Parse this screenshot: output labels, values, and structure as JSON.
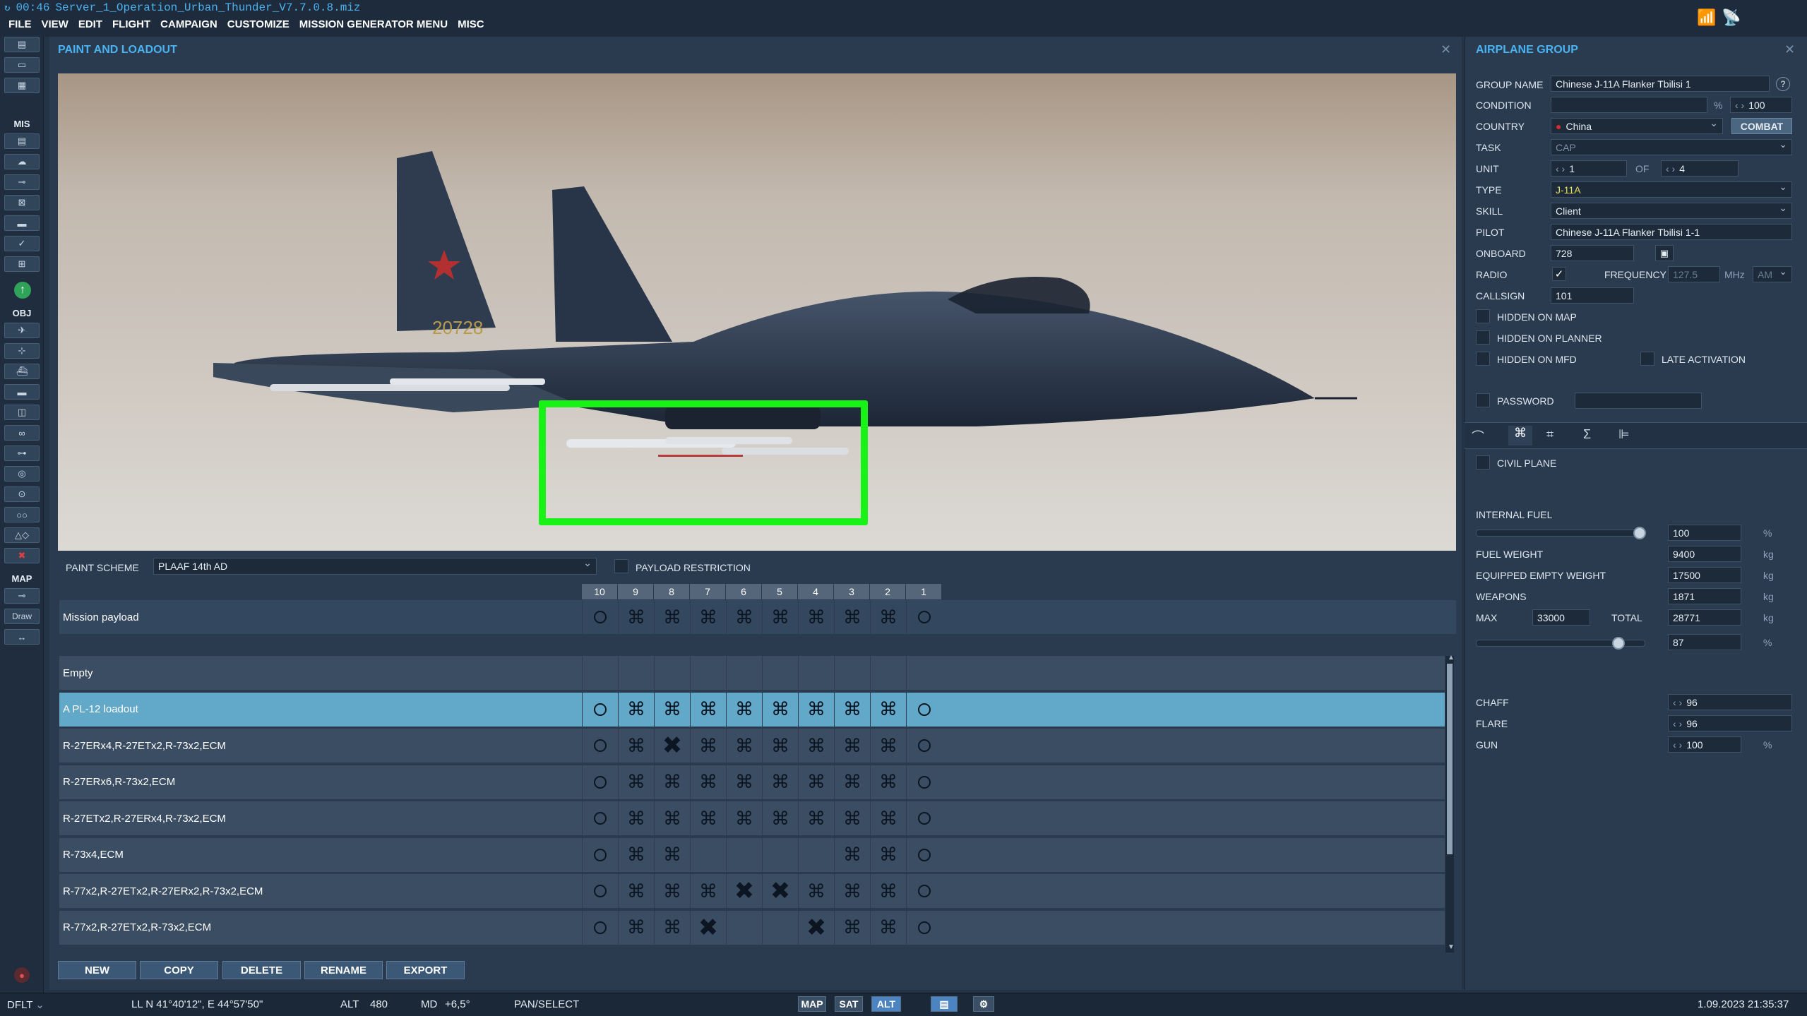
{
  "app": {
    "time": "00:46",
    "file": "Server_1_Operation_Urban_Thunder_V7.7.0.8.miz"
  },
  "menu": [
    "FILE",
    "VIEW",
    "EDIT",
    "FLIGHT",
    "CAMPAIGN",
    "CUSTOMIZE",
    "MISSION GENERATOR MENU",
    "MISC"
  ],
  "lefttb": {
    "mis": "MIS",
    "obj": "OBJ",
    "map": "MAP",
    "draw": "Draw"
  },
  "paint": {
    "title": "PAINT AND LOADOUT",
    "scheme_label": "PAINT SCHEME",
    "scheme_value": "PLAAF 14th AD",
    "payload_restriction": "PAYLOAD RESTRICTION",
    "tail_number": "20728",
    "stations": [
      "10",
      "9",
      "8",
      "7",
      "6",
      "5",
      "4",
      "3",
      "2",
      "1"
    ],
    "mission_row": {
      "name": "Mission payload",
      "cells": [
        "o",
        "x",
        "x",
        "x",
        "x",
        "x",
        "x",
        "x",
        "x",
        "o"
      ]
    },
    "loadouts": [
      {
        "name": "Empty",
        "cells": [
          "",
          "",
          "",
          "",
          "",
          "",
          "",
          "",
          "",
          ""
        ]
      },
      {
        "name": "A PL-12 loadout",
        "cells": [
          "o",
          "x",
          "x",
          "x",
          "x",
          "x",
          "x",
          "x",
          "x",
          "o"
        ]
      },
      {
        "name": "R-27ERx4,R-27ETx2,R-73x2,ECM",
        "cells": [
          "o",
          "x",
          "X",
          "x",
          "x",
          "x",
          "x",
          "x",
          "x",
          "o"
        ]
      },
      {
        "name": "R-27ERx6,R-73x2,ECM",
        "cells": [
          "o",
          "x",
          "x",
          "x",
          "x",
          "x",
          "x",
          "x",
          "x",
          "o"
        ]
      },
      {
        "name": "R-27ETx2,R-27ERx4,R-73x2,ECM",
        "cells": [
          "o",
          "x",
          "x",
          "x",
          "x",
          "x",
          "x",
          "x",
          "x",
          "o"
        ]
      },
      {
        "name": "R-73x4,ECM",
        "cells": [
          "o",
          "x",
          "x",
          "",
          "",
          "",
          "",
          "x",
          "x",
          "o"
        ]
      },
      {
        "name": "R-77x2,R-27ETx2,R-27ERx2,R-73x2,ECM",
        "cells": [
          "o",
          "x",
          "x",
          "x",
          "X",
          "X",
          "x",
          "x",
          "x",
          "o"
        ]
      },
      {
        "name": "R-77x2,R-27ETx2,R-73x2,ECM",
        "cells": [
          "o",
          "x",
          "x",
          "X",
          "",
          "",
          "X",
          "x",
          "x",
          "o"
        ]
      }
    ],
    "buttons": [
      "NEW",
      "COPY",
      "DELETE",
      "RENAME",
      "EXPORT"
    ]
  },
  "group": {
    "title": "AIRPLANE GROUP",
    "labels": {
      "group_name": "GROUP NAME",
      "condition": "CONDITION",
      "country": "COUNTRY",
      "task": "TASK",
      "unit": "UNIT",
      "type": "TYPE",
      "skill": "SKILL",
      "pilot": "PILOT",
      "onboard": "ONBOARD",
      "radio": "RADIO",
      "frequency": "FREQUENCY",
      "callsign": "CALLSIGN",
      "hidden_map": "HIDDEN ON MAP",
      "hidden_planner": "HIDDEN ON PLANNER",
      "hidden_mfd": "HIDDEN ON MFD",
      "late_activation": "LATE ACTIVATION",
      "password": "PASSWORD",
      "civil": "CIVIL PLANE",
      "internal_fuel": "INTERNAL FUEL",
      "fuel_weight": "FUEL WEIGHT",
      "empty_weight": "EQUIPPED EMPTY WEIGHT",
      "weapons": "WEAPONS",
      "max": "MAX",
      "total": "TOTAL",
      "chaff": "CHAFF",
      "flare": "FLARE",
      "gun": "GUN",
      "of": "OF",
      "combat": "COMBAT",
      "help": "?"
    },
    "values": {
      "group_name": "Chinese J-11A Flanker Tbilisi 1",
      "condition": "100",
      "country": "China",
      "task": "CAP",
      "unit": "1",
      "unit_of": "4",
      "type": "J-11A",
      "skill": "Client",
      "pilot": "Chinese J-11A Flanker Tbilisi 1-1",
      "onboard": "728",
      "frequency": "127.5",
      "mhz": "MHz",
      "modulation": "AM",
      "callsign": "101",
      "fuel": "100",
      "fuel_weight": "9400",
      "empty_weight": "17500",
      "weapons": "1871",
      "max": "33000",
      "total": "28771",
      "load_pct": "87",
      "chaff": "96",
      "flare": "96",
      "gun": "100"
    },
    "units": {
      "pct": "%",
      "kg": "kg"
    },
    "fuel_fraction": 1.0,
    "load_fraction": 0.87
  },
  "status": {
    "profile": "DFLT",
    "coords": "LL  N 41°40'12\", E 44°57'50\"",
    "alt_label": "ALT",
    "alt": "480",
    "md_label": "MD",
    "md": "+6,5°",
    "mode": "PAN/SELECT",
    "map": "MAP",
    "sat": "SAT",
    "alt_btn": "ALT",
    "datetime": "1.09.2023 21:35:37"
  },
  "colors": {
    "accent": "#4ab3f2",
    "highlight": "#19f216",
    "selected_row": "#62a8c8"
  }
}
